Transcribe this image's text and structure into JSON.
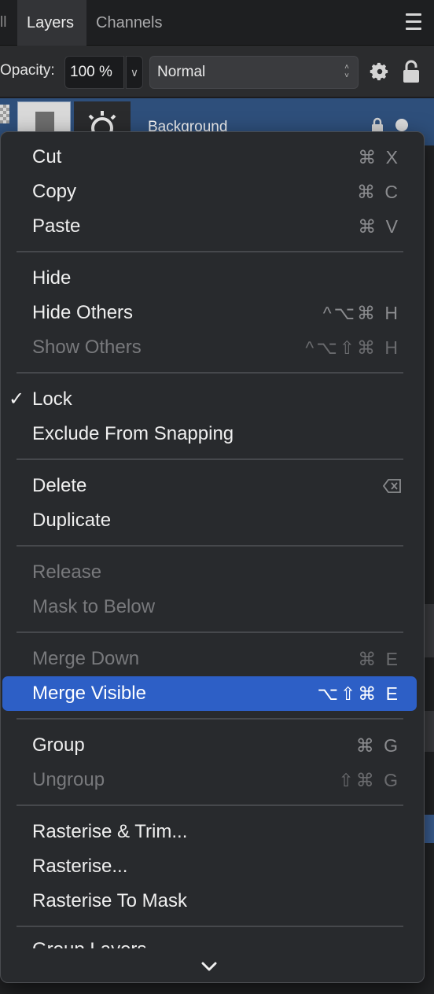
{
  "tabs": {
    "sliver_label": "ll",
    "active": "Layers",
    "inactive": "Channels"
  },
  "toolbar": {
    "opacity_label": "Opacity:",
    "opacity_value": "100 %",
    "opacity_dropdown_glyph": "∨",
    "blend_mode": "Normal",
    "blend_arrows_up": "˄",
    "blend_arrows_down": "˅"
  },
  "layer": {
    "name": "Background"
  },
  "colors": {
    "menu_background": "#282a2d",
    "highlight": "#2d5fc6",
    "selected_layer_row": "#2e4f7b"
  },
  "context_menu": {
    "items": [
      {
        "label": "Cut",
        "shortcut": "⌘ X"
      },
      {
        "label": "Copy",
        "shortcut": "⌘ C"
      },
      {
        "label": "Paste",
        "shortcut": "⌘ V"
      },
      {
        "label": "Hide",
        "shortcut": ""
      },
      {
        "label": "Hide Others",
        "shortcut": "^⌥⌘ H"
      },
      {
        "label": "Show Others",
        "shortcut": "^⌥⇧⌘ H"
      },
      {
        "label": "Lock",
        "check": "✓"
      },
      {
        "label": "Exclude From Snapping"
      },
      {
        "label": "Delete",
        "shortcut_icon": "delete-backward-icon"
      },
      {
        "label": "Duplicate"
      },
      {
        "label": "Release"
      },
      {
        "label": "Mask to Below"
      },
      {
        "label": "Merge Down",
        "shortcut": "⌘ E"
      },
      {
        "label": "Merge Visible",
        "shortcut": "⌥⇧⌘ E"
      },
      {
        "label": "Group",
        "shortcut": "⌘ G"
      },
      {
        "label": "Ungroup",
        "shortcut": "⇧⌘ G"
      },
      {
        "label": "Rasterise & Trim..."
      },
      {
        "label": "Rasterise..."
      },
      {
        "label": "Rasterise To Mask"
      },
      {
        "label": "Group Layers"
      }
    ],
    "disabled": [
      "Show Others",
      "Release",
      "Mask to Below",
      "Merge Down",
      "Ungroup"
    ],
    "highlighted": "Merge Visible",
    "checked": [
      "Lock"
    ]
  }
}
